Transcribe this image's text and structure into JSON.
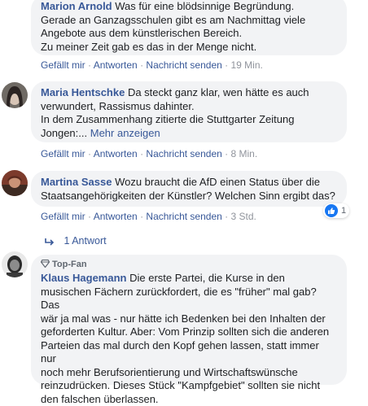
{
  "comments": [
    {
      "author": "Marion Arnold",
      "text_first": "Was für eine blödsinnige Begründung.",
      "lines": [
        "Gerade an Ganzagsschulen gibt es am Nachmittag viele",
        "Angebote aus dem künstlerischen Bereich.",
        "Zu meiner Zeit gab es das in der Menge nicht."
      ],
      "like": "Gefällt mir",
      "reply": "Antworten",
      "message": "Nachricht senden",
      "time": "19 Min."
    },
    {
      "author": "Maria Hentschke",
      "text_first": "Da steckt ganz klar, wen hätte es auch",
      "lines": [
        "verwundert, Rassismus dahinter.",
        "In dem Zusammenhang zitierte die Stuttgarter Zeitung"
      ],
      "last_line": "Jongen:...",
      "more": "Mehr anzeigen",
      "like": "Gefällt mir",
      "reply": "Antworten",
      "message": "Nachricht senden",
      "time": "8 Min."
    },
    {
      "author": "Martina Sasse",
      "text_first": "Wozu braucht die AfD einen Status über die",
      "lines": [
        "Staatsangehörigkeiten der Künstler? Welchen Sinn ergibt das?"
      ],
      "like": "Gefällt mir",
      "reply": "Antworten",
      "message": "Nachricht senden",
      "time": "3 Std.",
      "reaction_count": "1",
      "replies_label": "1 Antwort"
    },
    {
      "badge": "Top-Fan",
      "author": "Klaus Hagemann",
      "text_first": "Die erste Partei, die Kurse in den",
      "lines": [
        "musischen Fächern zurückfordert, die es \"früher\" mal gab? Das",
        "wär ja mal was - nur hätte ich Bedenken bei den Inhalten der",
        "geforderten Kultur. Aber: Vom Prinzip sollten sich die anderen",
        "Parteien das mal durch den Kopf gehen lassen, statt immer nur",
        "noch mehr Berufsorientierung und Wirtschaftswünsche",
        "reinzudrücken. Dieses Stück \"Kampfgebiet\" sollten sie nicht",
        "den falschen überlassen."
      ]
    }
  ],
  "colors": {
    "link": "#385898",
    "bubble": "#f2f3f5",
    "meta": "#90949c",
    "like_blue": "#1877f2"
  }
}
